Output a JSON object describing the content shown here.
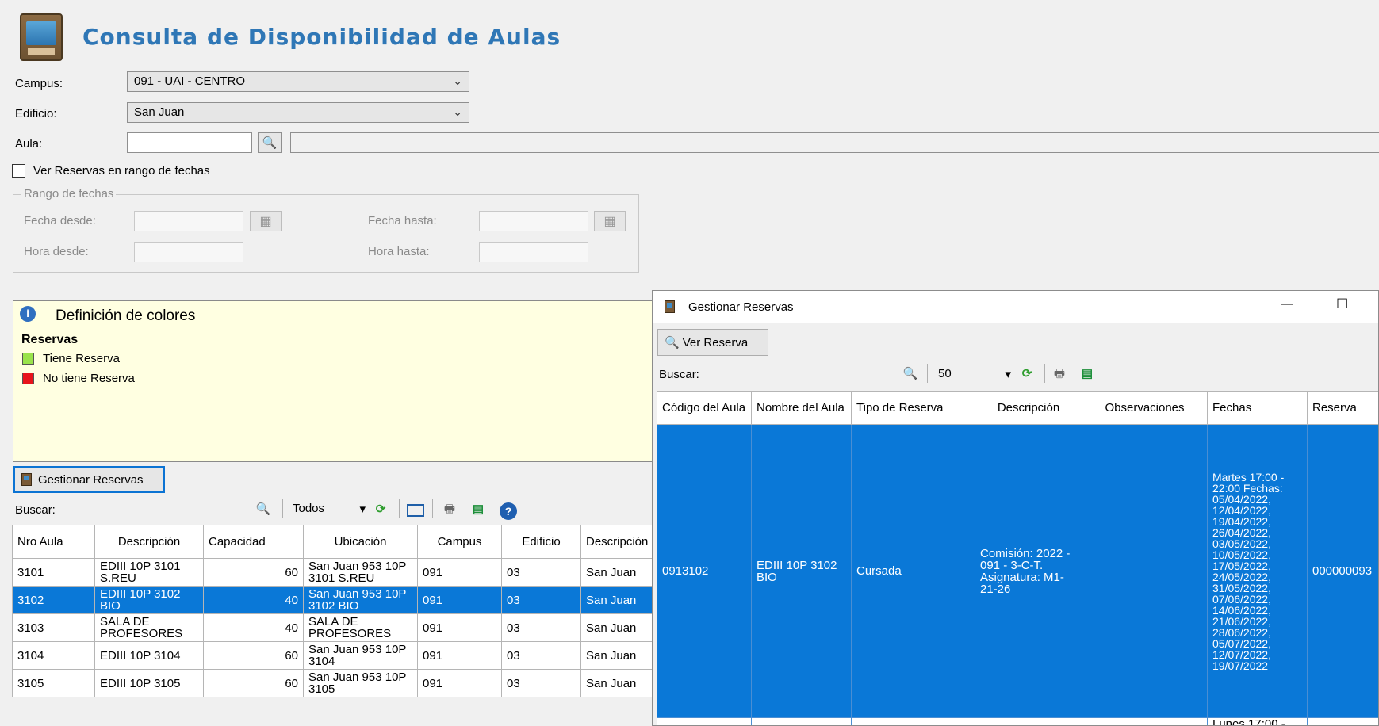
{
  "page": {
    "title": "Consulta de Disponibilidad de Aulas"
  },
  "filters": {
    "campus_label": "Campus:",
    "campus_value": "091 - UAI - CENTRO",
    "edificio_label": "Edificio:",
    "edificio_value": "San Juan",
    "aula_label": "Aula:",
    "ver_reservas_label": "Ver Reservas en rango de fechas",
    "rango_title": "Rango de fechas",
    "fecha_desde_label": "Fecha desde:",
    "fecha_hasta_label": "Fecha hasta:",
    "hora_desde_label": "Hora desde:",
    "hora_hasta_label": "Hora hasta:"
  },
  "legend": {
    "title": "Definición de colores",
    "section": "Reservas",
    "items": [
      {
        "label": "Tiene Reserva",
        "color": "#99e34b"
      },
      {
        "label": "No tiene Reserva",
        "color": "#e8141b"
      }
    ]
  },
  "gestionar_button": "Gestionar Reservas",
  "main_toolbar": {
    "buscar_label": "Buscar:",
    "filter_value": "Todos"
  },
  "main_table": {
    "headers": [
      "Nro Aula",
      "Descripción",
      "Capacidad",
      "Ubicación",
      "Campus",
      "Edificio",
      "Descripción Edificio"
    ],
    "rows": [
      {
        "nro": "3101",
        "desc": "EDIII 10P 3101 S.REU",
        "cap": "60",
        "ubic": "San Juan 953 10P 3101 S.REU",
        "campus": "091",
        "edif": "03",
        "desc_edif": "San Juan"
      },
      {
        "nro": "3102",
        "desc": "EDIII 10P 3102 BIO",
        "cap": "40",
        "ubic": "San Juan 953 10P 3102 BIO",
        "campus": "091",
        "edif": "03",
        "desc_edif": "San Juan"
      },
      {
        "nro": "3103",
        "desc": "SALA DE PROFESORES",
        "cap": "40",
        "ubic": "SALA DE PROFESORES",
        "campus": "091",
        "edif": "03",
        "desc_edif": "San Juan"
      },
      {
        "nro": "3104",
        "desc": "EDIII 10P 3104",
        "cap": "60",
        "ubic": "San Juan 953 10P 3104",
        "campus": "091",
        "edif": "03",
        "desc_edif": "San Juan"
      },
      {
        "nro": "3105",
        "desc": "EDIII 10P 3105",
        "cap": "60",
        "ubic": "San Juan 953 10P 3105",
        "campus": "091",
        "edif": "03",
        "desc_edif": "San Juan"
      }
    ]
  },
  "dialog": {
    "title": "Gestionar Reservas",
    "minimize": "—",
    "maximize": "☐",
    "ver_reserva": "Ver Reserva",
    "buscar_label": "Buscar:",
    "page_size": "50",
    "headers": [
      "Código del Aula",
      "Nombre del Aula",
      "Tipo de Reserva",
      "Descripción",
      "Observaciones",
      "Fechas",
      "Reserva"
    ],
    "row": {
      "codigo": "0913102",
      "nombre": "EDIII 10P 3102 BIO",
      "tipo": "Cursada",
      "descripcion": "Comisión: 2022 - 091 - 3-C-T. Asignatura: M1-21-26",
      "observaciones": "",
      "fechas": "Martes 17:00 - 22:00 Fechas: 05/04/2022, 12/04/2022, 19/04/2022, 26/04/2022, 03/05/2022, 10/05/2022, 17/05/2022, 24/05/2022, 31/05/2022, 07/06/2022, 14/06/2022, 21/06/2022, 28/06/2022, 05/07/2022, 12/07/2022, 19/07/2022",
      "reserva": "000000093"
    },
    "next_row_fechas": "Lunes 17:00 -"
  }
}
